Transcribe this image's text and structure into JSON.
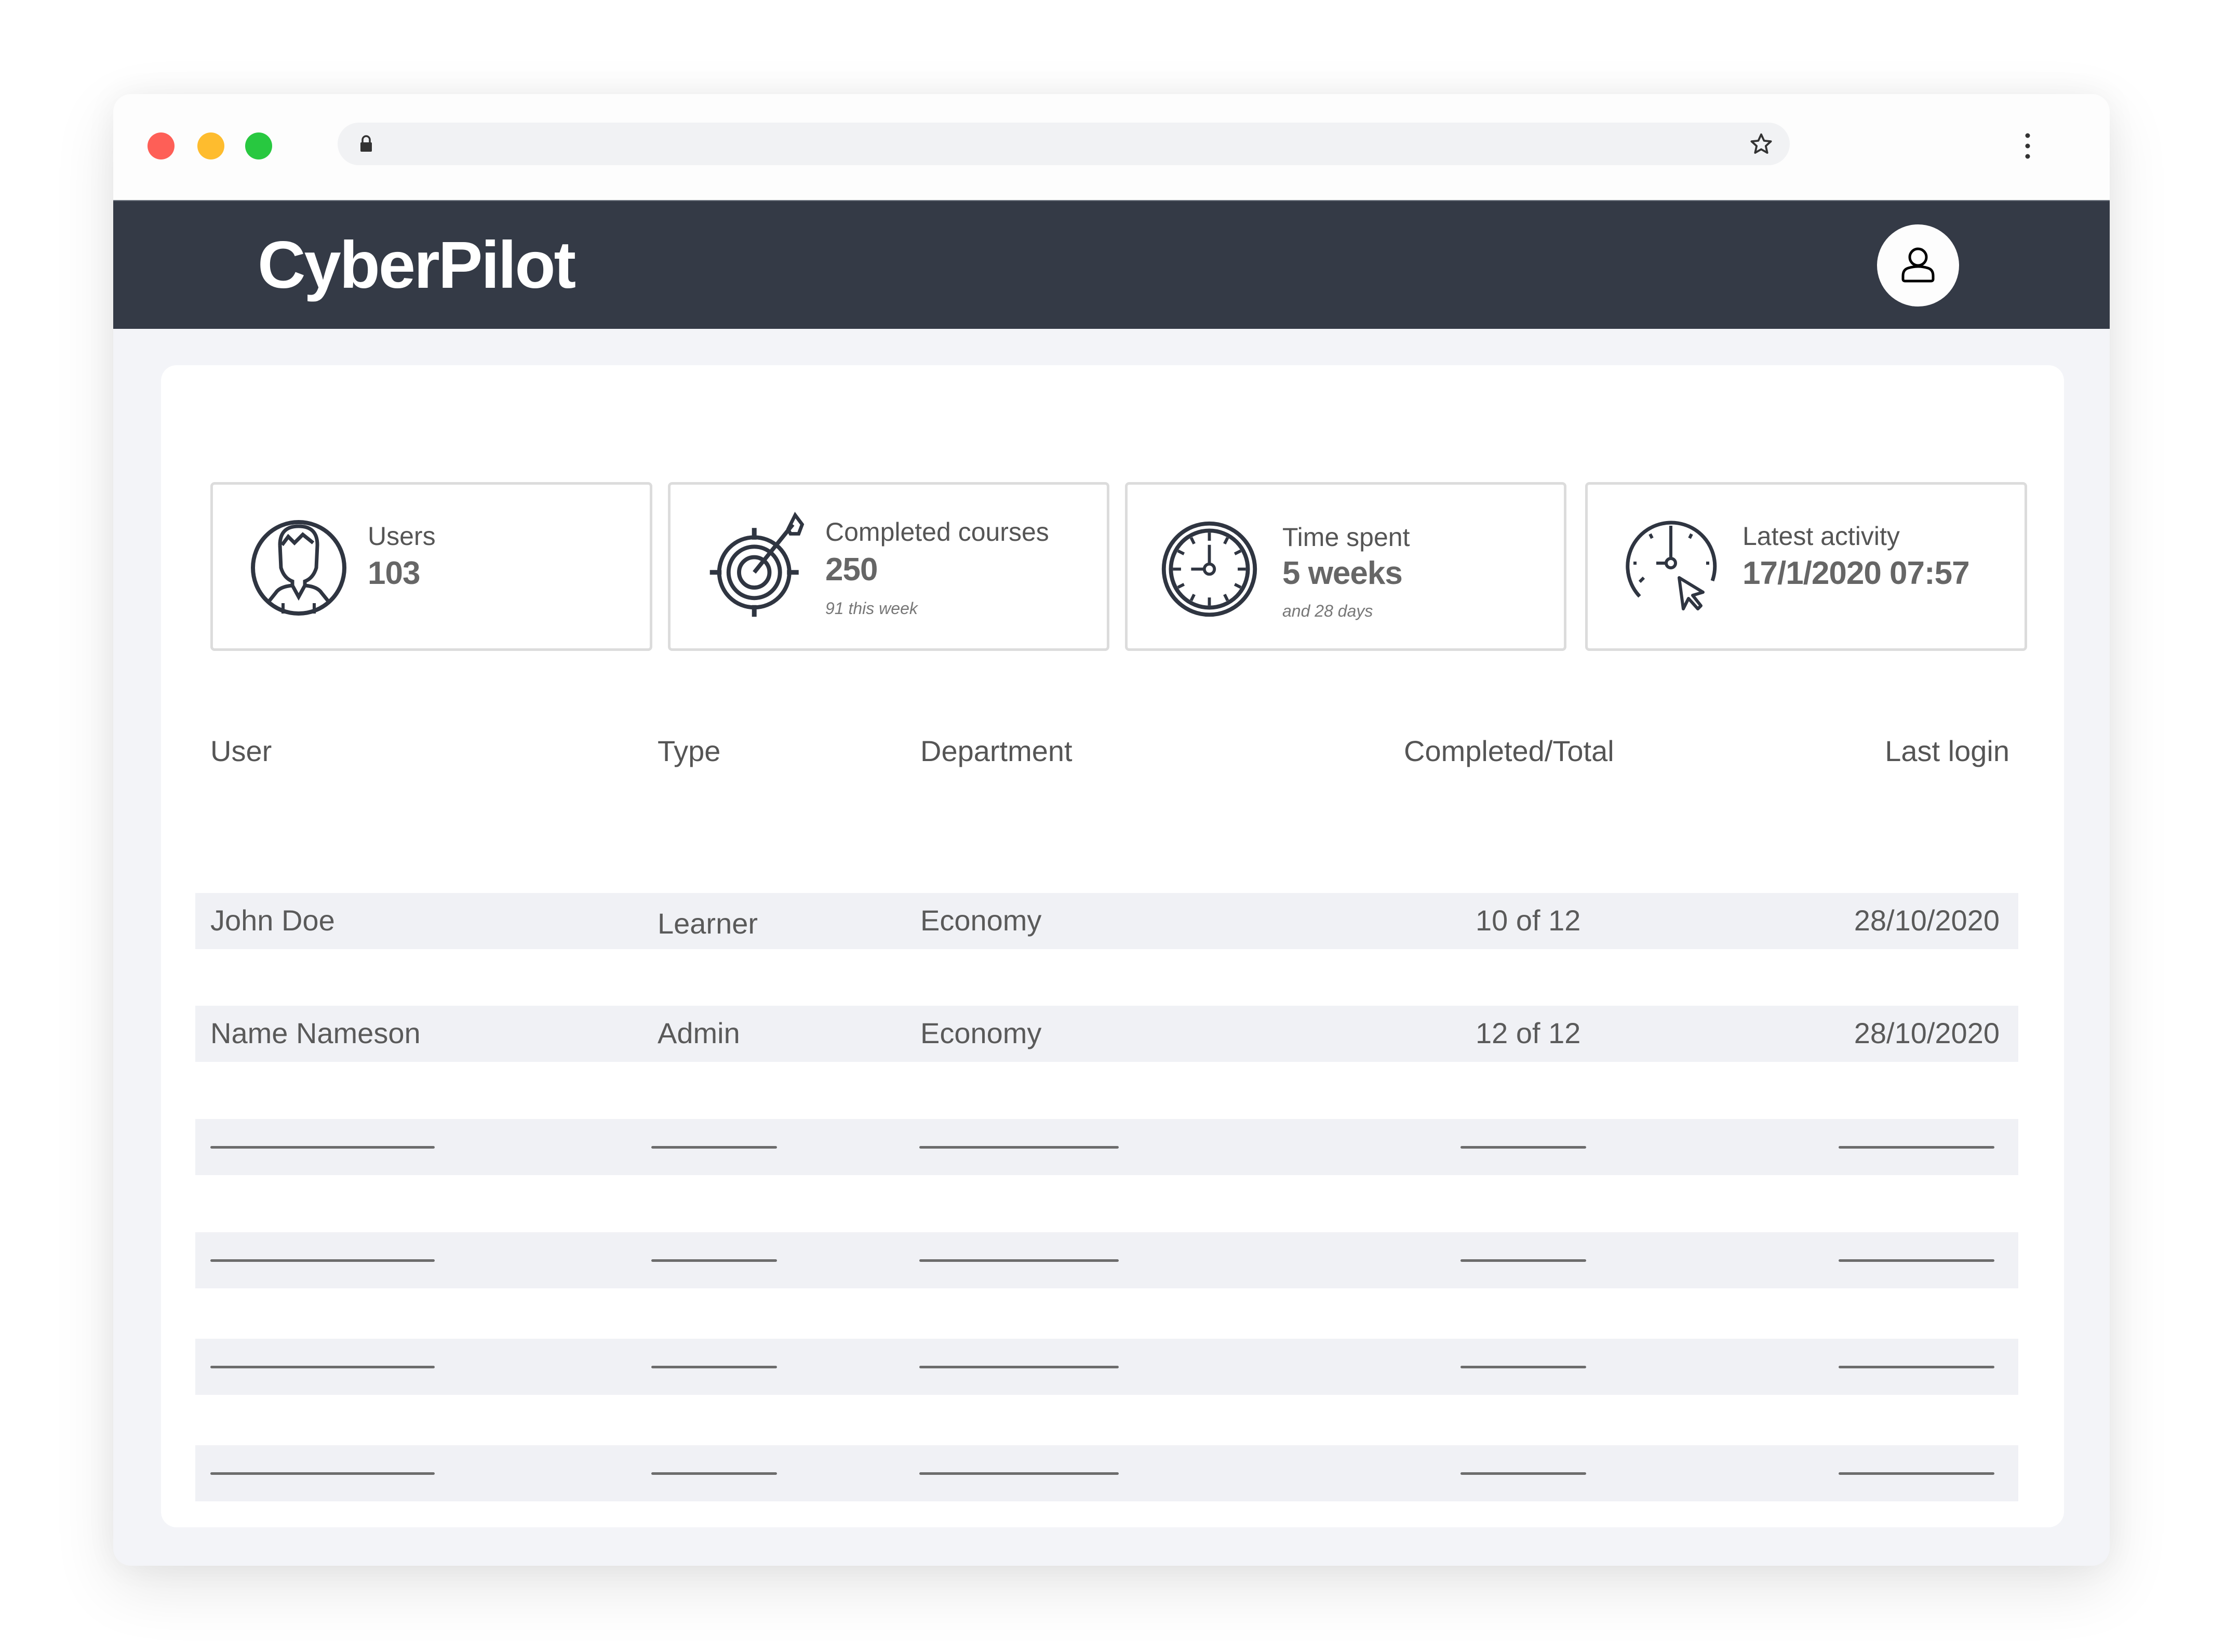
{
  "browser": {
    "url": "",
    "icons": {
      "lock": "lock-icon",
      "bookmark": "star-icon",
      "menu": "kebab-menu-icon"
    }
  },
  "app": {
    "brand": "CyberPilot",
    "header_bg": "#343a46",
    "profile_icon": "user-icon"
  },
  "stats": [
    {
      "icon": "user-circle-icon",
      "label": "Users",
      "value": "103",
      "sub": ""
    },
    {
      "icon": "target-arrow-icon",
      "label": "Completed courses",
      "value": "250",
      "sub": "91 this week"
    },
    {
      "icon": "stopwatch-icon",
      "label": "Time spent",
      "value": "5 weeks",
      "sub": "and 28 days"
    },
    {
      "icon": "clock-cursor-icon",
      "label": "Latest activity",
      "value": "17/1/2020 07:57",
      "sub": ""
    }
  ],
  "table": {
    "columns": [
      "User",
      "Type",
      "Department",
      "Completed/Total",
      "Last login"
    ],
    "rows": [
      [
        "John Doe",
        "Learner",
        "Economy",
        "10 of 12",
        "28/10/2020"
      ],
      [
        "Name Nameson",
        "Admin",
        "Economy",
        "12 of 12",
        "28/10/2020"
      ]
    ],
    "placeholder_rows": 4
  }
}
